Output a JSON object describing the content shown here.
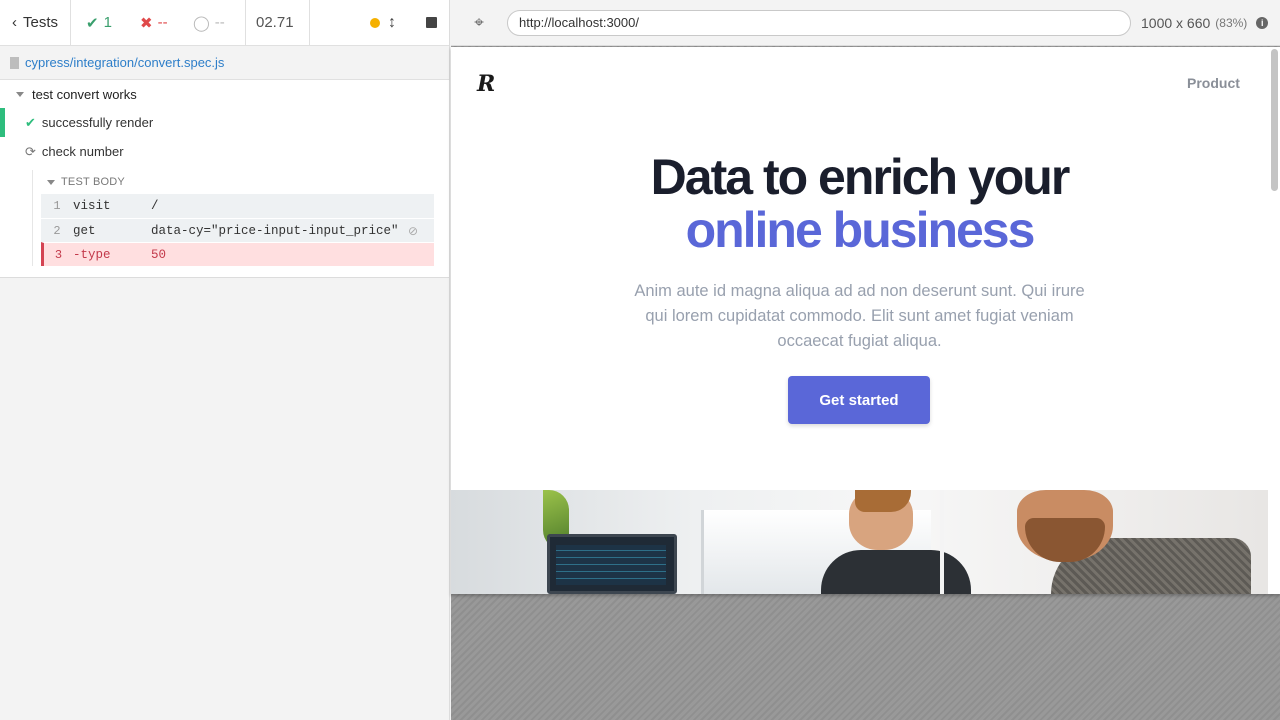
{
  "reporter": {
    "tests_label": "Tests",
    "passed_count": "1",
    "failed_count": "--",
    "pending_count": "--",
    "duration": "02.71",
    "spec_path": "cypress/integration/convert.spec.js",
    "suite": {
      "title": "test convert works"
    },
    "tests": [
      {
        "title": "successfully render",
        "state": "passed"
      },
      {
        "title": "check number",
        "state": "running"
      }
    ],
    "test_body_label": "TEST BODY",
    "commands": [
      {
        "num": "1",
        "name": "visit",
        "message": "/"
      },
      {
        "num": "2",
        "name": "get",
        "message": "data-cy=\"price-input-input_price\""
      },
      {
        "num": "3",
        "name": "-type",
        "message": "50"
      }
    ]
  },
  "preview": {
    "url": "http://localhost:3000/",
    "viewport_size": "1000 x 660",
    "zoom": "(83%)"
  },
  "aut": {
    "logo": "R",
    "nav_product": "Product",
    "headline_line1": "Data to enrich your",
    "headline_line2": "online business",
    "description": "Anim aute id magna aliqua ad ad non deserunt sunt. Qui irure qui lorem cupidatat commodo. Elit sunt amet fugiat veniam occaecat fugiat aliqua.",
    "cta_label": "Get started",
    "accent_color": "#5a67d8"
  },
  "colors": {
    "passed": "#2ebd7d",
    "failed": "#e0494a",
    "pending_indicator": "#f5b000",
    "link": "#2d7ec9"
  }
}
